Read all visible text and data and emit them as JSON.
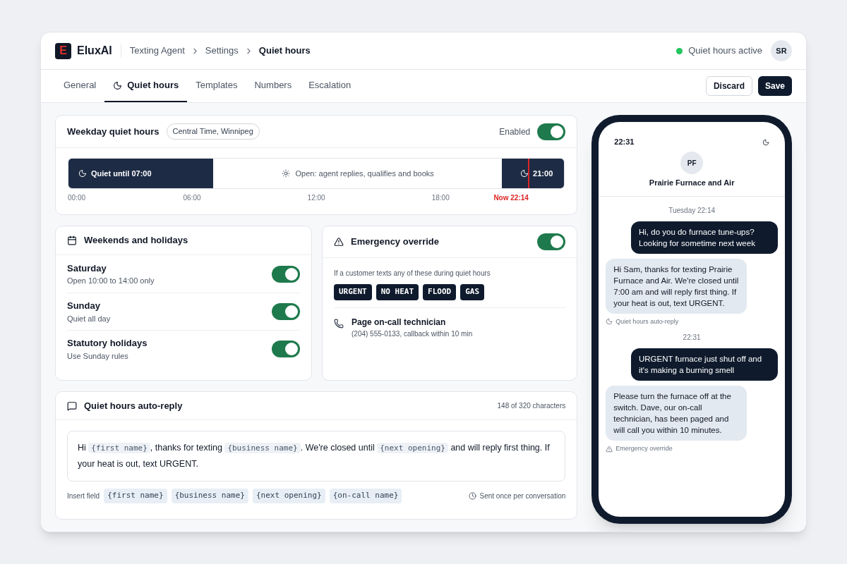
{
  "brand": {
    "logo_letter": "E",
    "name": "EluxAI"
  },
  "breadcrumbs": [
    {
      "label": "Texting Agent",
      "current": false
    },
    {
      "label": "Settings",
      "current": false
    },
    {
      "label": "Quiet hours",
      "current": true
    }
  ],
  "status": {
    "label": "Quiet hours active",
    "color": "#22c55e"
  },
  "user": {
    "initials": "SR"
  },
  "tabs": [
    {
      "label": "General",
      "selected": false
    },
    {
      "label": "Quiet hours",
      "selected": true
    },
    {
      "label": "Templates",
      "selected": false
    },
    {
      "label": "Numbers",
      "selected": false
    },
    {
      "label": "Escalation",
      "selected": false
    }
  ],
  "actions": [
    {
      "label": "Discard",
      "kind": "secondary"
    },
    {
      "label": "Save",
      "kind": "primary"
    }
  ],
  "weekday": {
    "title": "Weekday quiet hours",
    "timezone": "Central Time, Winnipeg",
    "toggle_label": "Enabled",
    "on": true,
    "segments": [
      {
        "kind": "quiet",
        "label": "Quiet until 07:00"
      },
      {
        "kind": "open",
        "label": "Open: agent replies, qualifies and books"
      },
      {
        "kind": "quiet",
        "label": "21:00"
      }
    ],
    "now": {
      "label": "Now 22:14",
      "level": 0.927
    },
    "ticks": [
      "00:00",
      "06:00",
      "12:00",
      "18:00"
    ]
  },
  "weekends": {
    "title": "Weekends and holidays",
    "rows": [
      {
        "label": "Saturday",
        "detail": "Open 10:00 to 14:00 only",
        "on": true
      },
      {
        "label": "Sunday",
        "detail": "Quiet all day",
        "on": true
      },
      {
        "label": "Statutory holidays",
        "detail": "Use Sunday rules",
        "on": true
      }
    ]
  },
  "emergency": {
    "title": "Emergency override",
    "on": true,
    "hint": "If a customer texts any of these during quiet hours",
    "keywords": [
      "URGENT",
      "NO HEAT",
      "FLOOD",
      "GAS"
    ],
    "action_title": "Page on-call technician",
    "action_detail": "(204) 555-0133, callback within 10 min"
  },
  "auto_reply": {
    "title": "Quiet hours auto-reply",
    "count": "148 of 320 characters",
    "message": [
      {
        "kind": "text",
        "text": "Hi "
      },
      {
        "kind": "field",
        "text": "{first name}"
      },
      {
        "kind": "text",
        "text": ", thanks for texting "
      },
      {
        "kind": "field",
        "text": "{business name}"
      },
      {
        "kind": "text",
        "text": ". We're closed until "
      },
      {
        "kind": "field",
        "text": "{next opening}"
      },
      {
        "kind": "text",
        "text": " and will reply first thing. If your heat is out, text URGENT."
      }
    ],
    "insert_label": "Insert field",
    "fields": [
      "{first name}",
      "{business name}",
      "{next opening}",
      "{on-call name}"
    ],
    "frequency": "Sent once per conversation"
  },
  "phone": {
    "time": "22:31",
    "avatar": "PF",
    "contact": "Prairie Furnace and Air",
    "messages": [
      {
        "kind": "timestamp",
        "text": "Tuesday 22:14"
      },
      {
        "kind": "outgoing",
        "text": "Hi, do you do furnace tune-ups? Looking for sometime next week"
      },
      {
        "kind": "incoming",
        "text": "Hi Sam, thanks for texting Prairie Furnace and Air. We're closed until 7:00 am and will reply first thing. If your heat is out, text URGENT.",
        "note": {
          "kind": "quiet",
          "text": "Quiet hours auto-reply"
        }
      },
      {
        "kind": "timestamp",
        "text": "22:31"
      },
      {
        "kind": "outgoing",
        "text": "URGENT furnace just shut off and it's making a burning smell"
      },
      {
        "kind": "incoming",
        "text": "Please turn the furnace off at the switch. Dave, our on-call technician, has been paged and will call you within 10 minutes.",
        "note": {
          "kind": "emergency",
          "text": "Emergency override"
        }
      }
    ]
  }
}
